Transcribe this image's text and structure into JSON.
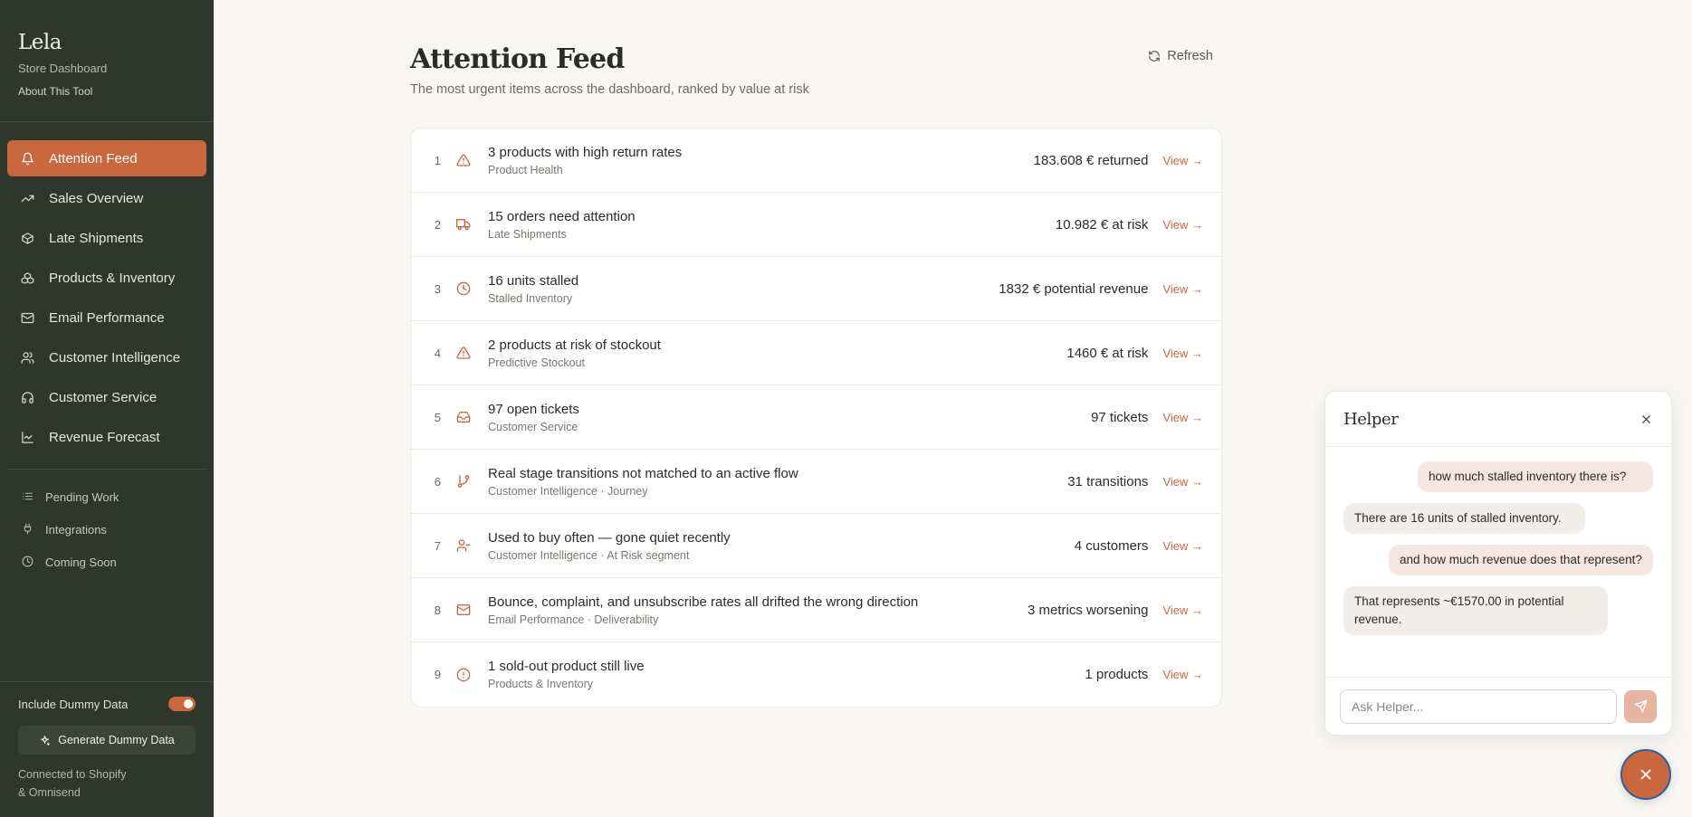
{
  "brand": {
    "title": "Lela",
    "subtitle": "Store Dashboard",
    "about": "About This Tool"
  },
  "nav": [
    {
      "label": "Attention Feed",
      "icon": "bell-icon",
      "active": true
    },
    {
      "label": "Sales Overview",
      "icon": "trending-up-icon"
    },
    {
      "label": "Late Shipments",
      "icon": "package-icon"
    },
    {
      "label": "Products & Inventory",
      "icon": "boxes-icon"
    },
    {
      "label": "Email Performance",
      "icon": "mail-icon"
    },
    {
      "label": "Customer Intelligence",
      "icon": "users-icon"
    },
    {
      "label": "Customer Service",
      "icon": "headphones-icon"
    },
    {
      "label": "Revenue Forecast",
      "icon": "line-chart-icon"
    }
  ],
  "nav_secondary": [
    {
      "label": "Pending Work",
      "icon": "list-icon"
    },
    {
      "label": "Integrations",
      "icon": "plug-icon"
    },
    {
      "label": "Coming Soon",
      "icon": "clock-icon"
    }
  ],
  "sidebar_bottom": {
    "dummy_label": "Include Dummy Data",
    "dummy_on": true,
    "generate_label": "Generate Dummy Data",
    "connected_line1": "Connected to Shopify",
    "connected_line2": "& Omnisend"
  },
  "page": {
    "title": "Attention Feed",
    "subtitle": "The most urgent items across the dashboard, ranked by value at risk",
    "refresh_label": "Refresh"
  },
  "feed": [
    {
      "rank": "1",
      "icon": "alert-triangle-icon",
      "title": "3 products with high return rates",
      "source": "Product Health",
      "value": "183.608 € returned",
      "action": "View →"
    },
    {
      "rank": "2",
      "icon": "truck-icon",
      "title": "15 orders need attention",
      "source": "Late Shipments",
      "value": "10.982 € at risk",
      "action": "View →"
    },
    {
      "rank": "3",
      "icon": "clock-icon",
      "title": "16 units stalled",
      "source": "Stalled Inventory",
      "value": "1832 € potential revenue",
      "action": "View →"
    },
    {
      "rank": "4",
      "icon": "alert-triangle-icon",
      "title": "2 products at risk of stockout",
      "source": "Predictive Stockout",
      "value": "1460 € at risk",
      "action": "View →"
    },
    {
      "rank": "5",
      "icon": "inbox-icon",
      "title": "97 open tickets",
      "source": "Customer Service",
      "value": "97 tickets",
      "action": "View →"
    },
    {
      "rank": "6",
      "icon": "git-branch-icon",
      "title": "Real stage transitions not matched to an active flow",
      "source": "Customer Intelligence · Journey",
      "value": "31 transitions",
      "action": "View →"
    },
    {
      "rank": "7",
      "icon": "user-minus-icon",
      "title": "Used to buy often — gone quiet recently",
      "source": "Customer Intelligence · At Risk segment",
      "value": "4 customers",
      "action": "View →"
    },
    {
      "rank": "8",
      "icon": "mail-icon",
      "title": "Bounce, complaint, and unsubscribe rates all drifted the wrong direction",
      "source": "Email Performance · Deliverability",
      "value": "3 metrics worsening",
      "action": "View →"
    },
    {
      "rank": "9",
      "icon": "alert-circle-icon",
      "title": "1 sold-out product still live",
      "source": "Products & Inventory",
      "value": "1 products",
      "action": "View →"
    }
  ],
  "helper": {
    "title": "Helper",
    "messages": [
      {
        "role": "user",
        "text": "how much stalled inventory there is?"
      },
      {
        "role": "bot",
        "text": "There are 16 units of stalled inventory."
      },
      {
        "role": "user",
        "text": "and how much revenue does that represent?"
      },
      {
        "role": "bot",
        "text": "That represents ~€1570.00 in potential revenue."
      }
    ],
    "input_placeholder": "Ask Helper..."
  },
  "colors": {
    "accent": "#c9673f",
    "sidebar_bg": "#2f372c",
    "page_bg": "#f9f7f3"
  }
}
